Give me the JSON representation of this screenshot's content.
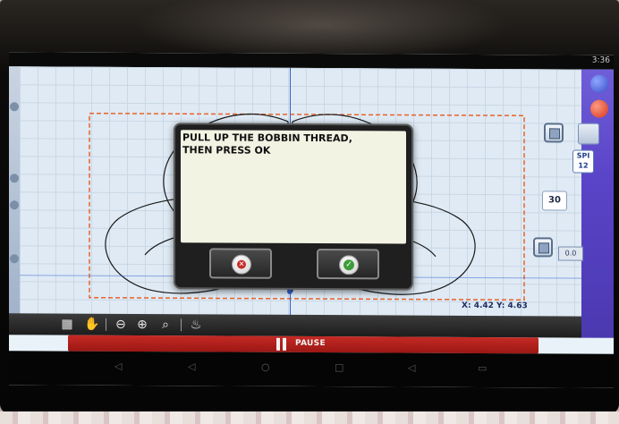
{
  "status_bar": {
    "time": "3:36"
  },
  "dialog": {
    "message": "PULL UP THE BOBBIN THREAD,\nTHEN PRESS OK",
    "cancel_icon": "cancel-x-icon",
    "ok_icon": "check-icon"
  },
  "right_panel": {
    "speed_value": "30",
    "spi_label": "SPI",
    "spi_value": "12",
    "offset_value": "0.0"
  },
  "coordinates": {
    "x_label": "X:",
    "x_value": "4.42",
    "y_label": "Y:",
    "y_value": "4.63"
  },
  "toolbar": {
    "icons": [
      "grid-icon",
      "hand-icon",
      "zoom-out-icon",
      "zoom-in-icon",
      "zoom-fit-icon",
      "fire-icon"
    ]
  },
  "pause_bar": {
    "label": "PAUSE"
  },
  "colors": {
    "pause_red": "#c52a24",
    "dialog_bg": "#1f1f1f",
    "message_bg": "#f3f3e4",
    "grid_bg": "#dfeaf4",
    "boundary_orange": "#e8632a",
    "side_strip_purple": "#5a44c8"
  }
}
